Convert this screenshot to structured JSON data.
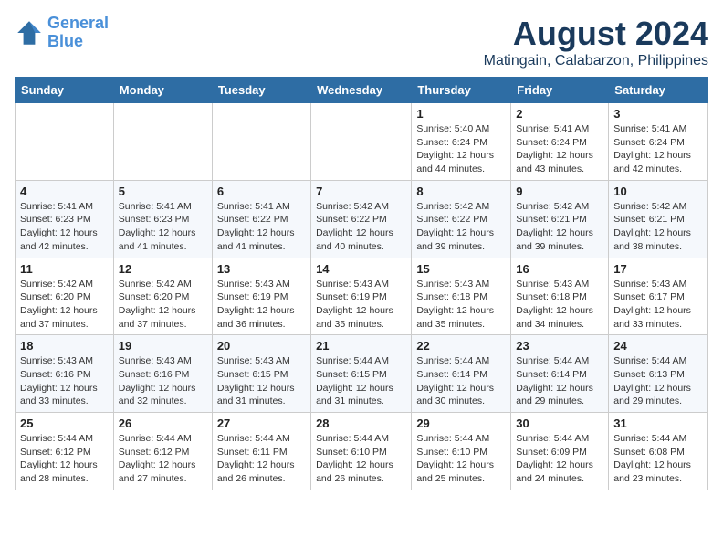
{
  "header": {
    "logo_line1": "General",
    "logo_line2": "Blue",
    "title": "August 2024",
    "subtitle": "Matingain, Calabarzon, Philippines"
  },
  "days_of_week": [
    "Sunday",
    "Monday",
    "Tuesday",
    "Wednesday",
    "Thursday",
    "Friday",
    "Saturday"
  ],
  "weeks": [
    [
      {
        "day": "",
        "info": ""
      },
      {
        "day": "",
        "info": ""
      },
      {
        "day": "",
        "info": ""
      },
      {
        "day": "",
        "info": ""
      },
      {
        "day": "1",
        "info": "Sunrise: 5:40 AM\nSunset: 6:24 PM\nDaylight: 12 hours\nand 44 minutes."
      },
      {
        "day": "2",
        "info": "Sunrise: 5:41 AM\nSunset: 6:24 PM\nDaylight: 12 hours\nand 43 minutes."
      },
      {
        "day": "3",
        "info": "Sunrise: 5:41 AM\nSunset: 6:24 PM\nDaylight: 12 hours\nand 42 minutes."
      }
    ],
    [
      {
        "day": "4",
        "info": "Sunrise: 5:41 AM\nSunset: 6:23 PM\nDaylight: 12 hours\nand 42 minutes."
      },
      {
        "day": "5",
        "info": "Sunrise: 5:41 AM\nSunset: 6:23 PM\nDaylight: 12 hours\nand 41 minutes."
      },
      {
        "day": "6",
        "info": "Sunrise: 5:41 AM\nSunset: 6:22 PM\nDaylight: 12 hours\nand 41 minutes."
      },
      {
        "day": "7",
        "info": "Sunrise: 5:42 AM\nSunset: 6:22 PM\nDaylight: 12 hours\nand 40 minutes."
      },
      {
        "day": "8",
        "info": "Sunrise: 5:42 AM\nSunset: 6:22 PM\nDaylight: 12 hours\nand 39 minutes."
      },
      {
        "day": "9",
        "info": "Sunrise: 5:42 AM\nSunset: 6:21 PM\nDaylight: 12 hours\nand 39 minutes."
      },
      {
        "day": "10",
        "info": "Sunrise: 5:42 AM\nSunset: 6:21 PM\nDaylight: 12 hours\nand 38 minutes."
      }
    ],
    [
      {
        "day": "11",
        "info": "Sunrise: 5:42 AM\nSunset: 6:20 PM\nDaylight: 12 hours\nand 37 minutes."
      },
      {
        "day": "12",
        "info": "Sunrise: 5:42 AM\nSunset: 6:20 PM\nDaylight: 12 hours\nand 37 minutes."
      },
      {
        "day": "13",
        "info": "Sunrise: 5:43 AM\nSunset: 6:19 PM\nDaylight: 12 hours\nand 36 minutes."
      },
      {
        "day": "14",
        "info": "Sunrise: 5:43 AM\nSunset: 6:19 PM\nDaylight: 12 hours\nand 35 minutes."
      },
      {
        "day": "15",
        "info": "Sunrise: 5:43 AM\nSunset: 6:18 PM\nDaylight: 12 hours\nand 35 minutes."
      },
      {
        "day": "16",
        "info": "Sunrise: 5:43 AM\nSunset: 6:18 PM\nDaylight: 12 hours\nand 34 minutes."
      },
      {
        "day": "17",
        "info": "Sunrise: 5:43 AM\nSunset: 6:17 PM\nDaylight: 12 hours\nand 33 minutes."
      }
    ],
    [
      {
        "day": "18",
        "info": "Sunrise: 5:43 AM\nSunset: 6:16 PM\nDaylight: 12 hours\nand 33 minutes."
      },
      {
        "day": "19",
        "info": "Sunrise: 5:43 AM\nSunset: 6:16 PM\nDaylight: 12 hours\nand 32 minutes."
      },
      {
        "day": "20",
        "info": "Sunrise: 5:43 AM\nSunset: 6:15 PM\nDaylight: 12 hours\nand 31 minutes."
      },
      {
        "day": "21",
        "info": "Sunrise: 5:44 AM\nSunset: 6:15 PM\nDaylight: 12 hours\nand 31 minutes."
      },
      {
        "day": "22",
        "info": "Sunrise: 5:44 AM\nSunset: 6:14 PM\nDaylight: 12 hours\nand 30 minutes."
      },
      {
        "day": "23",
        "info": "Sunrise: 5:44 AM\nSunset: 6:14 PM\nDaylight: 12 hours\nand 29 minutes."
      },
      {
        "day": "24",
        "info": "Sunrise: 5:44 AM\nSunset: 6:13 PM\nDaylight: 12 hours\nand 29 minutes."
      }
    ],
    [
      {
        "day": "25",
        "info": "Sunrise: 5:44 AM\nSunset: 6:12 PM\nDaylight: 12 hours\nand 28 minutes."
      },
      {
        "day": "26",
        "info": "Sunrise: 5:44 AM\nSunset: 6:12 PM\nDaylight: 12 hours\nand 27 minutes."
      },
      {
        "day": "27",
        "info": "Sunrise: 5:44 AM\nSunset: 6:11 PM\nDaylight: 12 hours\nand 26 minutes."
      },
      {
        "day": "28",
        "info": "Sunrise: 5:44 AM\nSunset: 6:10 PM\nDaylight: 12 hours\nand 26 minutes."
      },
      {
        "day": "29",
        "info": "Sunrise: 5:44 AM\nSunset: 6:10 PM\nDaylight: 12 hours\nand 25 minutes."
      },
      {
        "day": "30",
        "info": "Sunrise: 5:44 AM\nSunset: 6:09 PM\nDaylight: 12 hours\nand 24 minutes."
      },
      {
        "day": "31",
        "info": "Sunrise: 5:44 AM\nSunset: 6:08 PM\nDaylight: 12 hours\nand 23 minutes."
      }
    ]
  ]
}
